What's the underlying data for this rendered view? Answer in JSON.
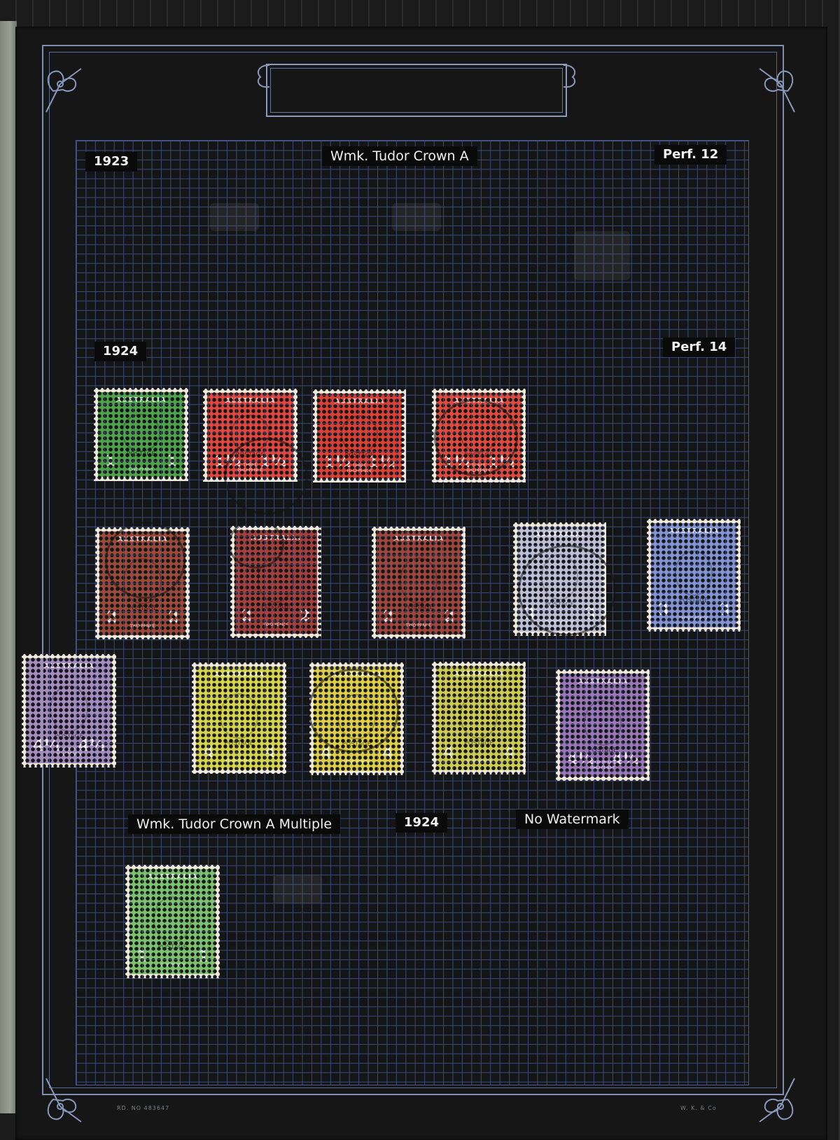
{
  "page": {
    "year_1923": "1923",
    "watermark_heading": "Wmk. Tudor Crown A",
    "perf_12": "Perf. 12",
    "year_1924": "1924",
    "perf_14": "Perf. 14",
    "multiple_heading": "Wmk. Tudor Crown A Multiple",
    "multiple_year": "1924",
    "no_watermark": "No Watermark",
    "footer_left": "RD. NO 483647",
    "footer_right": "W. K. & Co"
  },
  "stamps": [
    {
      "country": "AUSTRALIA",
      "postage": "POSTAGE",
      "value_left": "1",
      "value_right": "1",
      "value_text": "ONE PENNY",
      "color": "#4fa34b"
    },
    {
      "country": "AUSTRALIA",
      "postage": "POSTAGE",
      "value_left": "1½",
      "value_right": "1½",
      "value_text": "THREE HALFPENCE",
      "color": "#e2463c"
    },
    {
      "country": "AUSTRALIA",
      "postage": "POSTAGE",
      "value_left": "1½",
      "value_right": "1½",
      "value_text": "THREE HALFPENCE",
      "color": "#de3f33"
    },
    {
      "country": "AUSTRALIA",
      "postage": "POSTAGE",
      "value_left": "1½",
      "value_right": "1½",
      "value_text": "THREE HALFPENCE",
      "color": "#e14a3c"
    },
    {
      "country": "AUSTRALIA",
      "postage": "POSTAGE",
      "value_left": "2",
      "value_right": "2",
      "value_text": "TWO PENCE",
      "color": "#9e4a38"
    },
    {
      "country": "AUSTRALIA",
      "postage": "POSTAGE",
      "value_left": "2",
      "value_right": "2",
      "value_text": "TWO PENCE",
      "color": "#a43f3c"
    },
    {
      "country": "AUSTRALIA",
      "postage": "POSTAGE",
      "value_left": "2",
      "value_right": "2",
      "value_text": "TWO PENCE",
      "color": "#a0453c"
    },
    {
      "country": "AUSTRALIA",
      "postage": "POSTAGE",
      "value_left": "3",
      "value_right": "3",
      "value_text": "THREE PENCE",
      "color": "#bfc0d6"
    },
    {
      "country": "AUSTRALIA",
      "postage": "POSTAGE",
      "value_left": "3",
      "value_right": "3",
      "value_text": "THREE PENCE",
      "color": "#8394d4"
    },
    {
      "country": "AUSTRALIA",
      "postage": "POSTAGE",
      "value_left": "4½",
      "value_right": "4½",
      "value_text": "FOUR PENCE HALFPENNY",
      "color": "#a58cc0"
    },
    {
      "country": "AUSTRALIA",
      "postage": "POSTAGE",
      "value_left": "4",
      "value_right": "4",
      "value_text": "FOUR PENCE",
      "color": "#d7d44a"
    },
    {
      "country": "AUSTRALIA",
      "postage": "POSTAGE",
      "value_left": "4",
      "value_right": "4",
      "value_text": "FOUR PENCE",
      "color": "#e0cf45"
    },
    {
      "country": "AUSTRALIA",
      "postage": "POSTAGE",
      "value_left": "4",
      "value_right": "4",
      "value_text": "FOUR PENCE",
      "color": "#cfcb4c"
    },
    {
      "country": "AUSTRALIA",
      "postage": "POSTAGE",
      "value_left": "4½",
      "value_right": "4½",
      "value_text": "FOUR PENCE HALFPENNY",
      "color": "#9a78b8"
    },
    {
      "country": "AUSTRALIA",
      "postage": "POSTAGE",
      "value_left": "1",
      "value_right": "1",
      "value_text": "ONE PENNY",
      "color": "#7cc46a"
    }
  ]
}
